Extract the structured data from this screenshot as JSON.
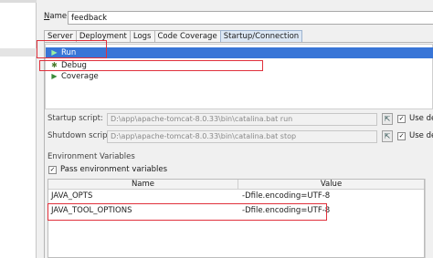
{
  "name_field": {
    "label_underlined": "N",
    "label_rest": "ame:",
    "value": "feedback"
  },
  "tabs": [
    {
      "label": "Server",
      "active": false
    },
    {
      "label": "Deployment",
      "active": false
    },
    {
      "label": "Logs",
      "active": false
    },
    {
      "label": "Code Coverage",
      "active": false
    },
    {
      "label": "Startup/Connection",
      "active": true
    }
  ],
  "modes": [
    {
      "label": "Run",
      "icon": "run-icon",
      "selected": true
    },
    {
      "label": "Debug",
      "icon": "debug-icon",
      "selected": false
    },
    {
      "label": "Coverage",
      "icon": "coverage-icon",
      "selected": false
    }
  ],
  "startup": {
    "label": "Startup script:",
    "value": "D:\\app\\apache-tomcat-8.0.33\\bin\\catalina.bat run",
    "default_label": "Use def"
  },
  "shutdown": {
    "label": "Shutdown script:",
    "value": "D:\\app\\apache-tomcat-8.0.33\\bin\\catalina.bat stop",
    "default_label": "Use def"
  },
  "env": {
    "title": "Environment Variables",
    "pass_label": "Pass environment variables",
    "columns": {
      "name": "Name",
      "value": "Value"
    },
    "rows": [
      {
        "name": "JAVA_OPTS",
        "value": "-Dfile.encoding=UTF-8"
      },
      {
        "name": "JAVA_TOOL_OPTIONS",
        "value": "-Dfile.encoding=UTF-8"
      }
    ]
  },
  "colors": {
    "selection": "#3875d7",
    "annotation": "#e0303c"
  }
}
